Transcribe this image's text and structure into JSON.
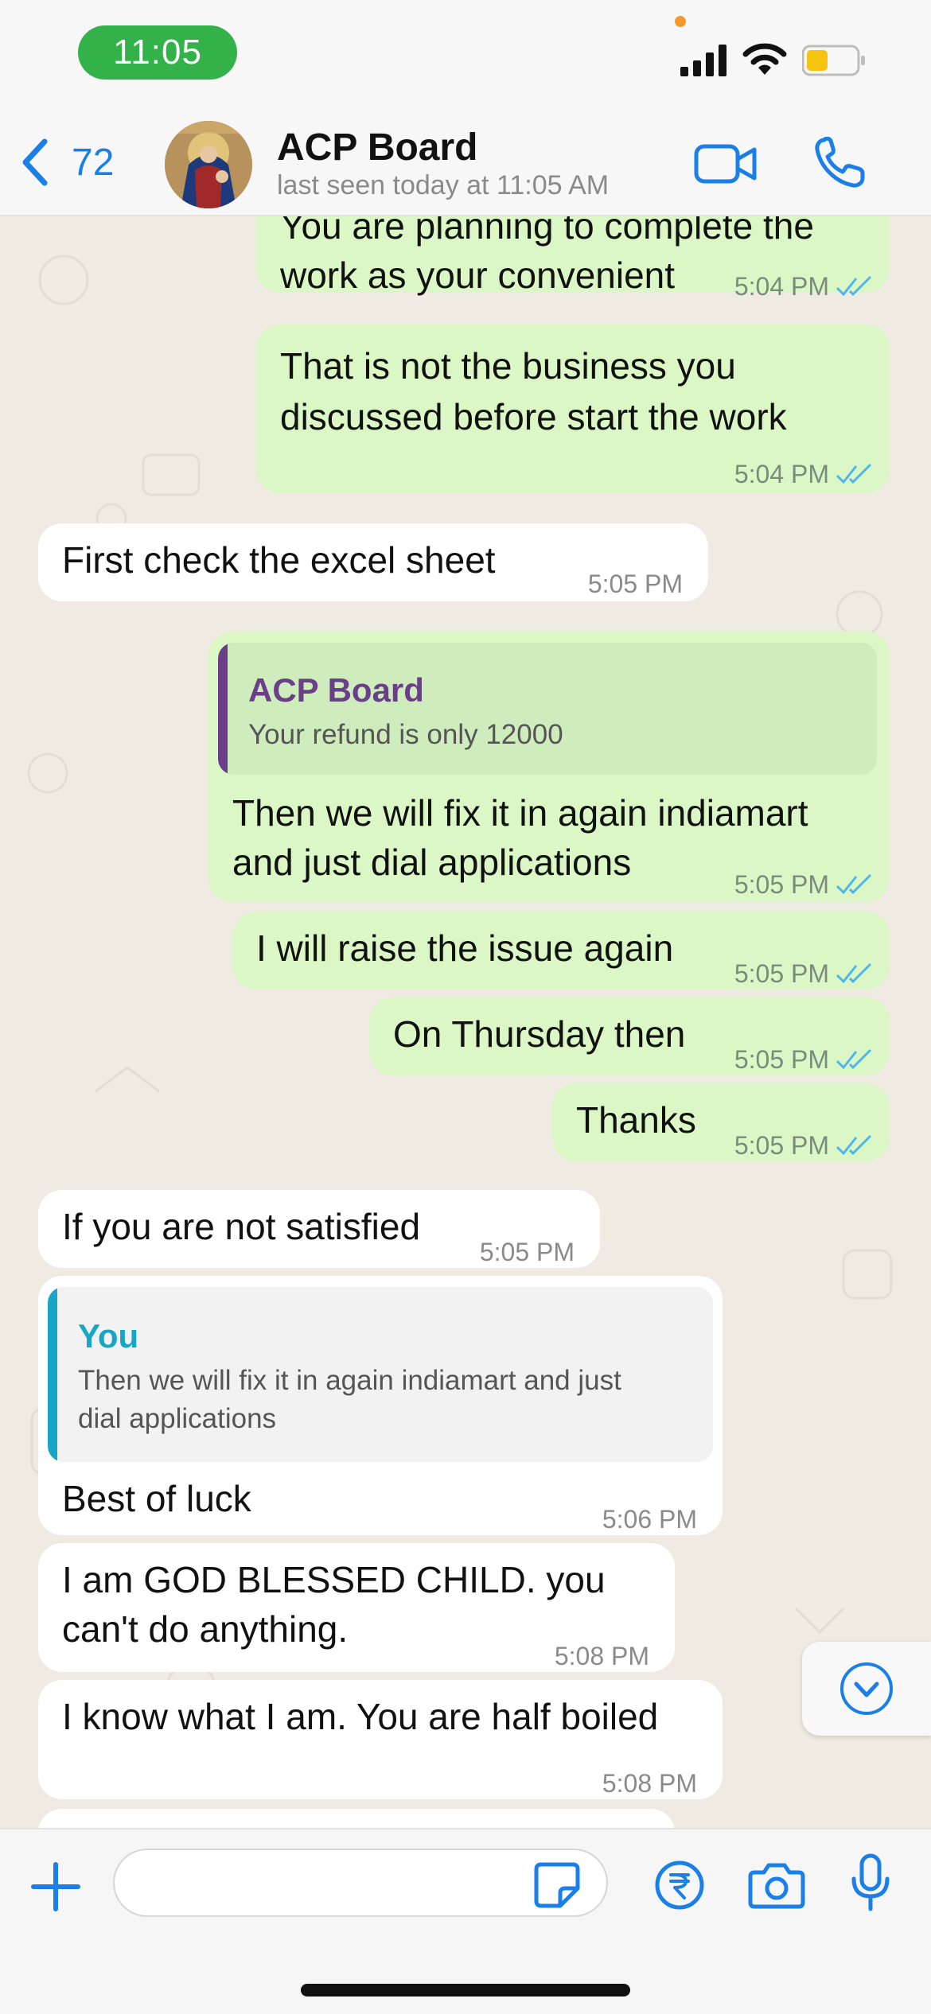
{
  "status_bar": {
    "time": "11:05"
  },
  "header": {
    "back_count": "72",
    "title": "ACP Board",
    "subtitle": "last seen today at 11:05 AM"
  },
  "colors": {
    "accent": "#1a7fe6",
    "outgoing_bubble": "#dbf7c6",
    "incoming_bubble": "#ffffff",
    "read_ticks": "#4fb6ec",
    "quote_purple": "#6b3e8a",
    "quote_teal": "#18a6c7"
  },
  "messages": [
    {
      "id": "m1",
      "dir": "out",
      "lines": [
        "You are planning to complete the",
        "work as your convenient"
      ],
      "time": "5:04 PM",
      "ticks": "read"
    },
    {
      "id": "m2",
      "dir": "out",
      "lines": [
        "That is not the business you",
        "discussed before start the work"
      ],
      "time": "5:04 PM",
      "ticks": "read"
    },
    {
      "id": "m3",
      "dir": "in",
      "lines": [
        "First check the excel sheet"
      ],
      "time": "5:05 PM"
    },
    {
      "id": "m4",
      "dir": "out",
      "quote": {
        "author": "ACP Board",
        "text": "Your refund is only 12000"
      },
      "lines": [
        "Then we will fix it in again indiamart",
        "and just dial applications"
      ],
      "time": "5:05 PM",
      "ticks": "read"
    },
    {
      "id": "m5",
      "dir": "out",
      "lines": [
        "I will raise the issue again"
      ],
      "time": "5:05 PM",
      "ticks": "read"
    },
    {
      "id": "m6",
      "dir": "out",
      "lines": [
        "On Thursday then"
      ],
      "time": "5:05 PM",
      "ticks": "read"
    },
    {
      "id": "m7",
      "dir": "out",
      "lines": [
        "Thanks"
      ],
      "time": "5:05 PM",
      "ticks": "read"
    },
    {
      "id": "m8",
      "dir": "in",
      "lines": [
        "If you are not satisfied"
      ],
      "time": "5:05 PM"
    },
    {
      "id": "m9",
      "dir": "in",
      "quote": {
        "author": "You",
        "lines": [
          "Then we will fix it in again indiamart and just",
          "dial applications"
        ]
      },
      "lines": [
        "Best of luck"
      ],
      "time": "5:06 PM"
    },
    {
      "id": "m10",
      "dir": "in",
      "lines": [
        "I am GOD BLESSED CHILD. you",
        "can't do anything."
      ],
      "time": "5:08 PM"
    },
    {
      "id": "m11",
      "dir": "in",
      "lines": [
        "I know what I am. You are half boiled"
      ],
      "time": "5:08 PM"
    }
  ],
  "icons": {
    "back": "chevron-left-icon",
    "video": "video-camera-icon",
    "call": "phone-icon",
    "scroll": "chevron-down-circle-icon",
    "attach": "plus-icon",
    "sticker": "sticker-icon",
    "payment": "rupee-icon",
    "camera": "camera-icon",
    "mic": "microphone-icon"
  }
}
